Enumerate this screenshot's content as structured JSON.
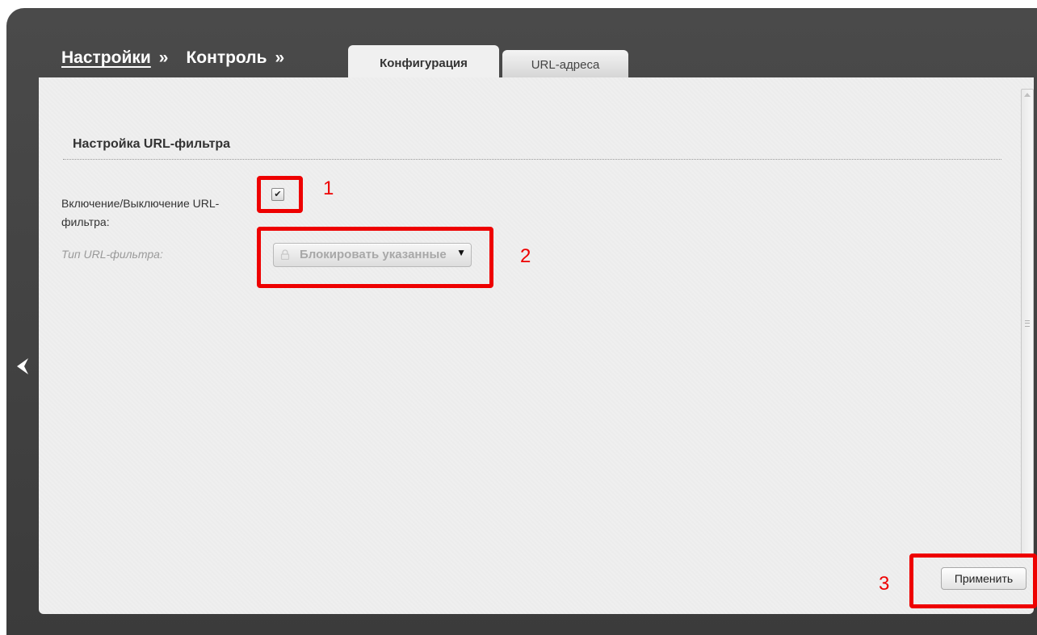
{
  "breadcrumb": {
    "settings": "Настройки",
    "sep1": "»",
    "control": "Контроль",
    "sep2": "»"
  },
  "tabs": [
    {
      "label": "Конфигурация",
      "active": true
    },
    {
      "label": "URL-адреса",
      "active": false
    }
  ],
  "section": {
    "title": "Настройка URL-фильтра"
  },
  "form": {
    "enable_label": "Включение/Выключение URL-фильтра:",
    "enable_checked": true,
    "checkmark": "✔",
    "type_label": "Тип URL-фильтра:",
    "type_value": "Блокировать указанные",
    "type_disabled": true,
    "select_arrow": "▼"
  },
  "actions": {
    "apply_label": "Применить"
  },
  "annotations": [
    "1",
    "2",
    "3"
  ],
  "icons": {
    "back": "chevron-left-icon",
    "lock": "lock-icon"
  },
  "colors": {
    "annotation": "#ee0000",
    "frame": "#444444",
    "panel": "#efefef"
  }
}
